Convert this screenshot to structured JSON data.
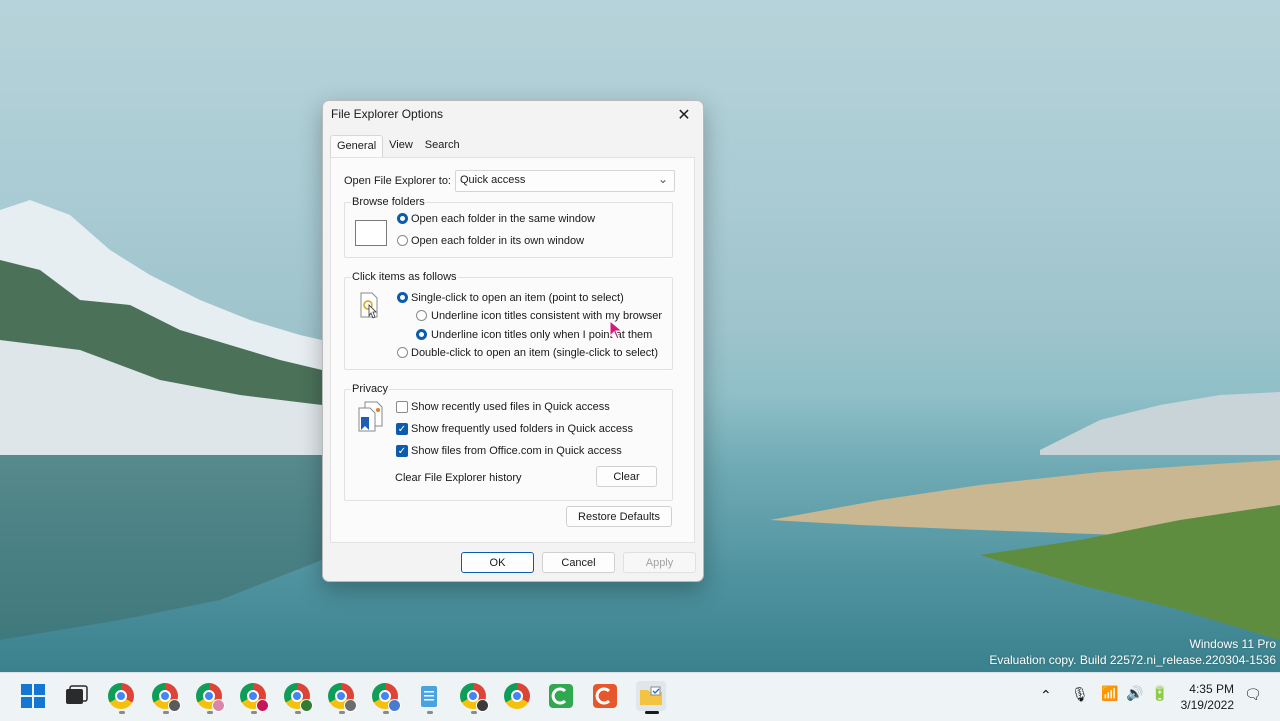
{
  "window": {
    "title": "File Explorer Options",
    "tabs": [
      {
        "label": "General",
        "active": true
      },
      {
        "label": "View",
        "active": false
      },
      {
        "label": "Search",
        "active": false
      }
    ]
  },
  "general": {
    "open_to_label": "Open File Explorer to:",
    "open_to_value": "Quick access",
    "browse": {
      "title": "Browse folders",
      "same_window": "Open each folder in the same window",
      "own_window": "Open each folder in its own window",
      "selected": "same_window"
    },
    "click": {
      "title": "Click items as follows",
      "single": "Single-click to open an item (point to select)",
      "underline_consistent": "Underline icon titles consistent with my browser",
      "underline_point": "Underline icon titles only when I point at them",
      "double": "Double-click to open an item (single-click to select)",
      "selected": "single",
      "underline_selected": "underline_point"
    },
    "privacy": {
      "title": "Privacy",
      "recent_files": {
        "label": "Show recently used files in Quick access",
        "checked": false
      },
      "frequent_folders": {
        "label": "Show frequently used folders in Quick access",
        "checked": true
      },
      "office_files": {
        "label": "Show files from Office.com in Quick access",
        "checked": true
      },
      "clear_label": "Clear File Explorer history",
      "clear_button": "Clear"
    },
    "restore_defaults": "Restore Defaults"
  },
  "buttons": {
    "ok": "OK",
    "cancel": "Cancel",
    "apply": "Apply"
  },
  "watermark": {
    "line1": "Windows 11 Pro",
    "line2": "Evaluation copy. Build 22572.ni_release.220304-1536"
  },
  "taskbar": {
    "time": "4:35 PM",
    "date": "3/19/2022"
  }
}
